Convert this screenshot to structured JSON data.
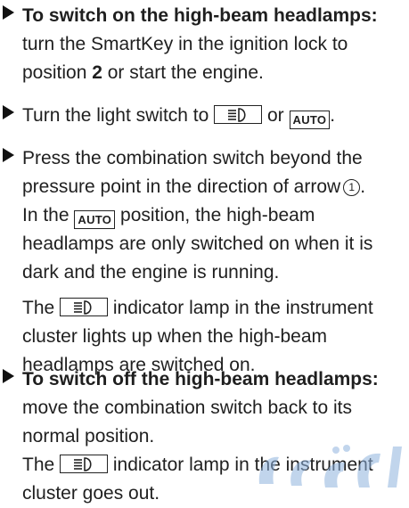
{
  "colors": {
    "text": "#1f1f1f",
    "arrow": "#111111",
    "watermark": "#8fb3de"
  },
  "icons": {
    "bullet": "triangle-right-icon",
    "high_beam": "high-beam-icon"
  },
  "step1": {
    "bold": "To switch on the high-beam headlamps:",
    "text_a": " turn the SmartKey in the ignition lock to position ",
    "position": "2",
    "text_b": " or start the engine."
  },
  "step2": {
    "text_a": "Turn the light switch to ",
    "text_b": " or ",
    "auto": "AUTO",
    "text_c": "."
  },
  "step3": {
    "text_a": "Press the combination switch beyond the pressure point in the direction of arrow",
    "arrow_number": "1",
    "text_b": ".",
    "note1_a": "In the ",
    "note1_auto": "AUTO",
    "note1_b": " position, the high-beam headlamps are only switched on when it is dark and the engine is running.",
    "note2_a": "The ",
    "note2_b": " indicator lamp in the instrument cluster lights up when the high-beam headlamps are switched on."
  },
  "step4": {
    "bold": "To switch off the high-beam headlamps:",
    "text_a": " move the combination switch back to its normal position.",
    "note_a": "The ",
    "note_b": " indicator lamp in the instrument cluster goes out."
  }
}
